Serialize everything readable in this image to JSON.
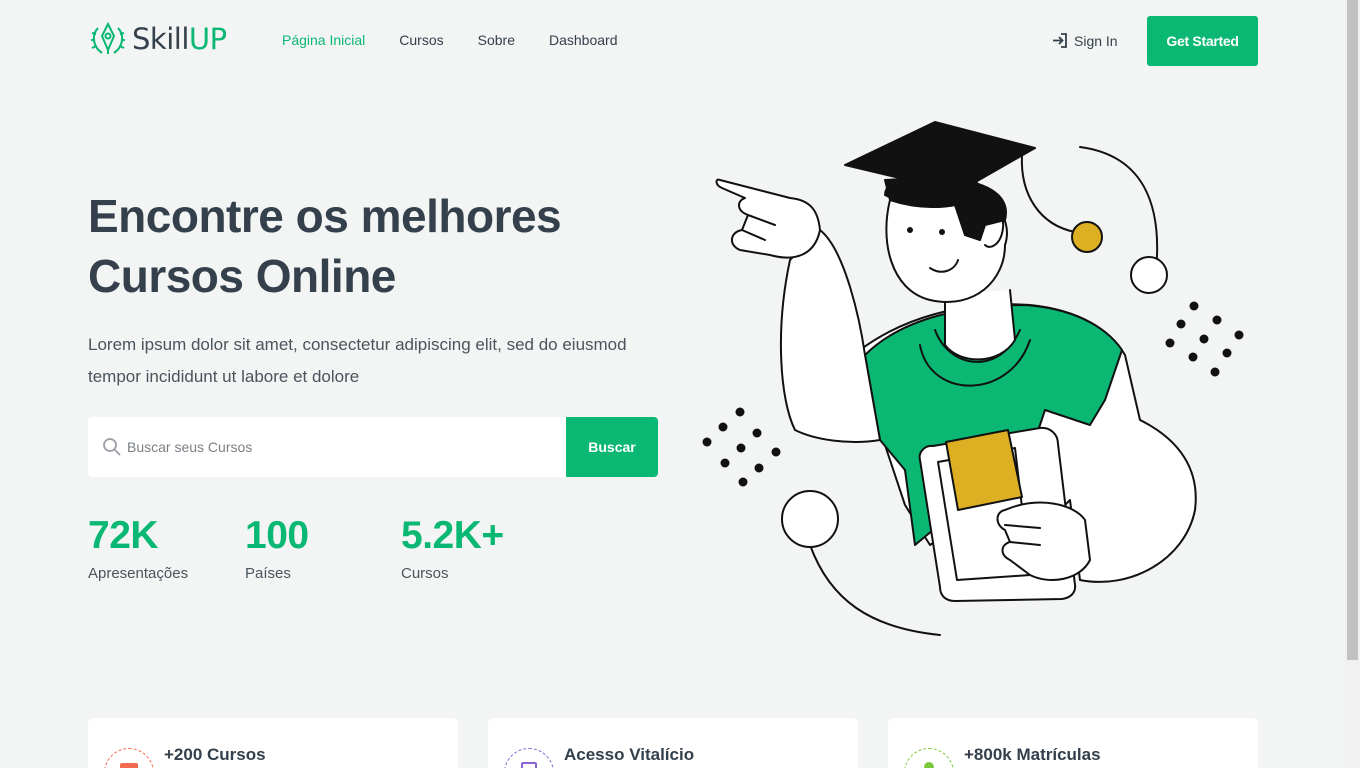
{
  "logo": {
    "text_main": "Skill",
    "text_accent": "UP",
    "icon": "laurel-pen-icon"
  },
  "nav": [
    {
      "label": "Página Inicial",
      "active": true
    },
    {
      "label": "Cursos",
      "active": false
    },
    {
      "label": "Sobre",
      "active": false
    },
    {
      "label": "Dashboard",
      "active": false
    }
  ],
  "header": {
    "signin_label": "Sign In",
    "signin_icon": "sign-in-icon",
    "cta_label": "Get Started"
  },
  "hero": {
    "title_line1": "Encontre os melhores",
    "title_line2": "Cursos Online",
    "subtitle": "Lorem ipsum dolor sit amet, consectetur adipiscing elit, sed do eiusmod tempor incididunt ut labore et dolore",
    "illustration": "graduate-student-illustration"
  },
  "search": {
    "placeholder": "Buscar seus Cursos",
    "value": "",
    "button_label": "Buscar"
  },
  "stats": [
    {
      "value": "72K",
      "label": "Apresentações"
    },
    {
      "value": "100",
      "label": "Países"
    },
    {
      "value": "5.2K+",
      "label": "Cursos"
    }
  ],
  "features": [
    {
      "title": "+200 Cursos",
      "icon": "course-icon",
      "color": "#f26b4f"
    },
    {
      "title": "Acesso Vitalício",
      "icon": "briefcase-icon",
      "color": "#8a63d2"
    },
    {
      "title": "+800k Matrículas",
      "icon": "user-icon",
      "color": "#7cc83b"
    }
  ],
  "colors": {
    "accent": "#0ab873",
    "text": "#34404b",
    "background": "#f3f4f4",
    "gold": "#ddb024"
  }
}
